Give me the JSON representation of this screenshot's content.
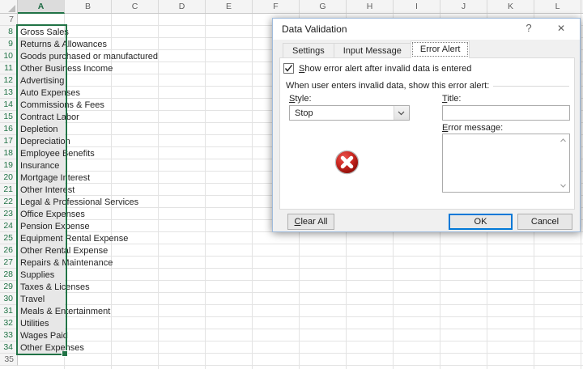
{
  "spreadsheet": {
    "columns": [
      {
        "label": "A",
        "selected": true
      },
      {
        "label": "B",
        "selected": false
      },
      {
        "label": "C",
        "selected": false
      },
      {
        "label": "D",
        "selected": false
      },
      {
        "label": "E",
        "selected": false
      },
      {
        "label": "F",
        "selected": false
      },
      {
        "label": "G",
        "selected": false
      },
      {
        "label": "H",
        "selected": false
      },
      {
        "label": "I",
        "selected": false
      },
      {
        "label": "J",
        "selected": false
      },
      {
        "label": "K",
        "selected": false
      },
      {
        "label": "L",
        "selected": false
      }
    ],
    "rows": [
      {
        "num": "7",
        "text": "",
        "selected": false
      },
      {
        "num": "8",
        "text": "Gross Sales",
        "selected": true,
        "active": true
      },
      {
        "num": "9",
        "text": "Returns & Allowances",
        "selected": true
      },
      {
        "num": "10",
        "text": "Goods purchased or manufactured",
        "selected": true
      },
      {
        "num": "11",
        "text": "Other Business Income",
        "selected": true
      },
      {
        "num": "12",
        "text": "Advertising",
        "selected": true
      },
      {
        "num": "13",
        "text": "Auto Expenses",
        "selected": true
      },
      {
        "num": "14",
        "text": "Commissions & Fees",
        "selected": true
      },
      {
        "num": "15",
        "text": "Contract Labor",
        "selected": true
      },
      {
        "num": "16",
        "text": "Depletion",
        "selected": true
      },
      {
        "num": "17",
        "text": "Depreciation",
        "selected": true
      },
      {
        "num": "18",
        "text": "Employee Benefits",
        "selected": true
      },
      {
        "num": "19",
        "text": "Insurance",
        "selected": true
      },
      {
        "num": "20",
        "text": "Mortgage Interest",
        "selected": true
      },
      {
        "num": "21",
        "text": "Other Interest",
        "selected": true
      },
      {
        "num": "22",
        "text": "Legal & Professional Services",
        "selected": true
      },
      {
        "num": "23",
        "text": "Office Expenses",
        "selected": true
      },
      {
        "num": "24",
        "text": "Pension Expense",
        "selected": true
      },
      {
        "num": "25",
        "text": "Equipment Rental Expense",
        "selected": true
      },
      {
        "num": "26",
        "text": "Other Rental Expense",
        "selected": true
      },
      {
        "num": "27",
        "text": "Repairs & Maintenance",
        "selected": true
      },
      {
        "num": "28",
        "text": "Supplies",
        "selected": true
      },
      {
        "num": "29",
        "text": "Taxes & Licenses",
        "selected": true
      },
      {
        "num": "30",
        "text": "Travel",
        "selected": true
      },
      {
        "num": "31",
        "text": "Meals & Entertainment",
        "selected": true
      },
      {
        "num": "32",
        "text": "Utilities",
        "selected": true
      },
      {
        "num": "33",
        "text": "Wages Paid",
        "selected": true
      },
      {
        "num": "34",
        "text": "Other Expenses",
        "selected": true
      },
      {
        "num": "35",
        "text": "",
        "selected": false
      }
    ],
    "selection": {
      "range": "A8:A34",
      "active_cell": "A8"
    }
  },
  "dialog": {
    "title": "Data Validation",
    "titlebar": {
      "help": "?",
      "close": "✕"
    },
    "tabs": [
      {
        "label": "Settings",
        "active": false
      },
      {
        "label": "Input Message",
        "active": false
      },
      {
        "label": "Error Alert",
        "active": true
      }
    ],
    "show_alert_checkbox": {
      "label": "Show error alert after invalid data is entered",
      "checked": true
    },
    "group_label": "When user enters invalid data, show this error alert:",
    "style_field": {
      "label": "Style:",
      "value": "Stop"
    },
    "title_field": {
      "label": "Title:",
      "value": ""
    },
    "error_message_field": {
      "label": "Error message:",
      "value": ""
    },
    "buttons": [
      {
        "label": "Clear All"
      },
      {
        "label": "OK",
        "default": true
      },
      {
        "label": "Cancel"
      }
    ]
  },
  "colors": {
    "excel_green": "#217346",
    "selection_fill": "#E7E7E7",
    "default_button_border": "#0078D7",
    "stop_icon_red": "#C00000",
    "dialog_border_blue": "#9FBBDC"
  }
}
